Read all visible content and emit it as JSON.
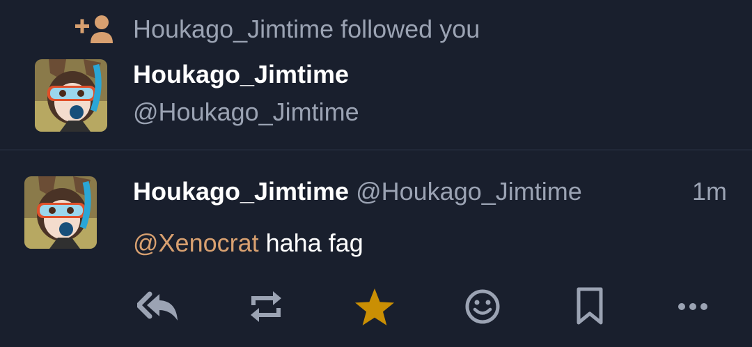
{
  "notification": {
    "text": "Houkago_Jimtime followed you",
    "account": {
      "display_name": "Houkago_Jimtime",
      "handle": "@Houkago_Jimtime"
    }
  },
  "status": {
    "display_name": "Houkago_Jimtime",
    "handle": "@Houkago_Jimtime",
    "time": "1m",
    "mention": "@Xenocrat",
    "text": " haha fag"
  },
  "actions": [
    {
      "name": "reply",
      "icon": "reply-all-icon"
    },
    {
      "name": "boost",
      "icon": "retweet-icon"
    },
    {
      "name": "favourite",
      "icon": "star-icon",
      "active": true
    },
    {
      "name": "react",
      "icon": "smile-icon"
    },
    {
      "name": "bookmark",
      "icon": "bookmark-icon"
    },
    {
      "name": "more",
      "icon": "more-horizontal-icon"
    }
  ],
  "colors": {
    "background": "#191f2d",
    "text": "#ffffff",
    "muted": "#9ba3b3",
    "accent": "#d8a070",
    "favourite": "#ca8f04"
  }
}
